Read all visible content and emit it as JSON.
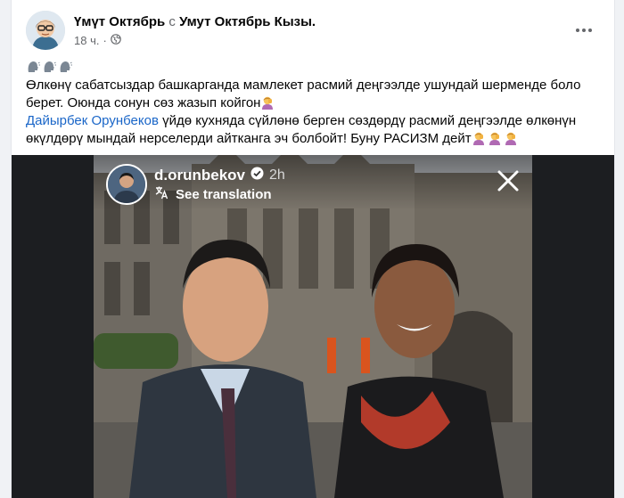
{
  "post": {
    "author": "Үмүт Октябрь",
    "joiner": "с",
    "tagged": "Умут Октябрь Кызы.",
    "time": "18 ч.",
    "privacy_icon": "globe-icon",
    "more_icon": "more-horizontal-icon",
    "line1_emojis": [
      "speaking-head-emoji",
      "speaking-head-emoji",
      "speaking-head-emoji"
    ],
    "paragraph1": "Өлкөнү сабатсыздар башкарганда мамлекет расмий деңгээлде ушундай шерменде боло берет. Оюнда сонун сөз жазып койгон",
    "mention": "Дайырбек Орунбеков",
    "paragraph2": " үйдө кухняда сүйлөнө берген сөздөрдү расмий деңгээлде өлкөнүн өкүлдөрү мындай нерселерди айтканга эч болбойт! Буну РАСИЗМ дейт",
    "facepalm_emoji": "woman-facepalming-emoji"
  },
  "story": {
    "username": "d.orunbekov",
    "verified_icon": "verified-badge-icon",
    "time": "2h",
    "see_translation": "See translation",
    "translate_icon": "translate-icon",
    "close_icon": "close-icon"
  },
  "colors": {
    "link": "#1a66c8",
    "secondary_text": "#65676b",
    "background": "#f0f2f5"
  }
}
